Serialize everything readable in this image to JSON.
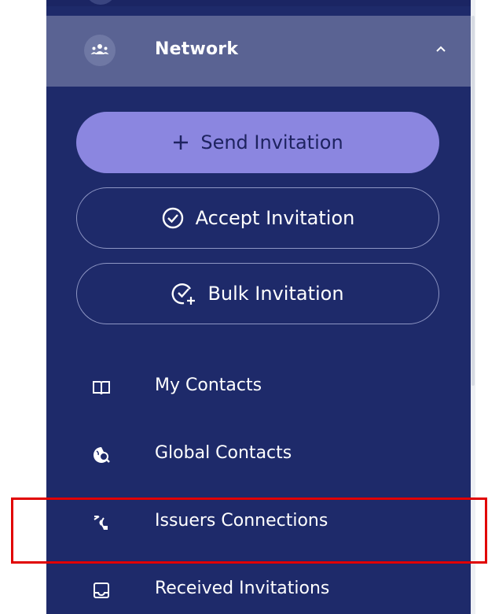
{
  "sidebar": {
    "network": {
      "label": "Network",
      "icon": "people-group-icon",
      "expanded": true
    },
    "actions": [
      {
        "label": "Send Invitation",
        "icon": "plus-icon"
      },
      {
        "label": "Accept Invitation",
        "icon": "check-circle-icon"
      },
      {
        "label": "Bulk Invitation",
        "icon": "check-circle-plus-icon"
      }
    ],
    "items": [
      {
        "label": "My Contacts",
        "icon": "book-open-icon"
      },
      {
        "label": "Global Contacts",
        "icon": "globe-search-icon"
      },
      {
        "label": "Issuers Connections",
        "icon": "signal-hand-icon"
      },
      {
        "label": "Received Invitations",
        "icon": "inbox-icon"
      }
    ]
  },
  "colors": {
    "sidebar_bg": "#1e2a6a",
    "header_bg": "#5a6393",
    "primary_button": "#8b86e0",
    "highlight": "#e10000"
  }
}
